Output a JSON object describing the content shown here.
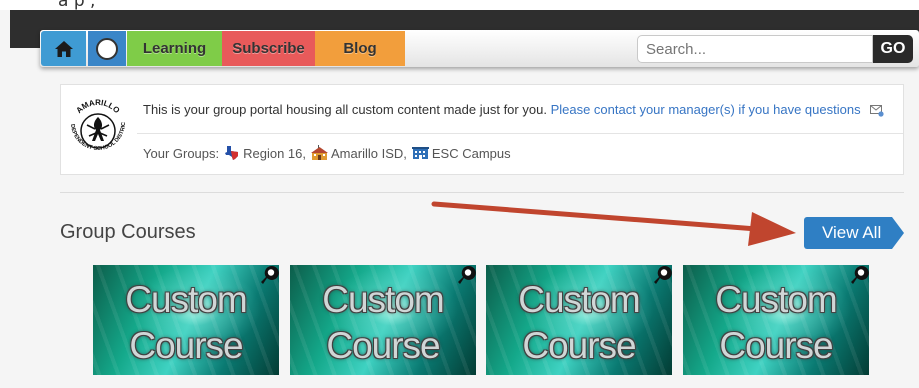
{
  "top_partial": "a p  ,",
  "nav": {
    "tabs": [
      "Learning",
      "Subscribe",
      "Blog"
    ],
    "search_placeholder": "Search...",
    "go_label": "GO"
  },
  "portal": {
    "message": "This is your group portal housing all custom content made just for you.",
    "contact_link": "Please contact your manager(s) if you have questions",
    "groups_label": "Your Groups:",
    "groups": [
      "Region 16,",
      "Amarillo ISD,",
      "ESC Campus"
    ],
    "seal": {
      "top_text": "AMARILLO",
      "ring_text": "INDEPENDENT SCHOOL DISTRICT"
    }
  },
  "section": {
    "title": "Group Courses",
    "view_all": "View All"
  },
  "courses": [
    {
      "line1": "Custom",
      "line2": "Course"
    },
    {
      "line1": "Custom",
      "line2": "Course"
    },
    {
      "line1": "Custom",
      "line2": "Course"
    },
    {
      "line1": "Custom",
      "line2": "Course"
    }
  ],
  "colors": {
    "home": "#3f9bd3",
    "learning": "#7fcc48",
    "subscribe": "#e85a5a",
    "blog": "#f29e3c",
    "view_all": "#2f7fc4",
    "link": "#3775c4",
    "annotation_arrow": "#c0452e"
  }
}
